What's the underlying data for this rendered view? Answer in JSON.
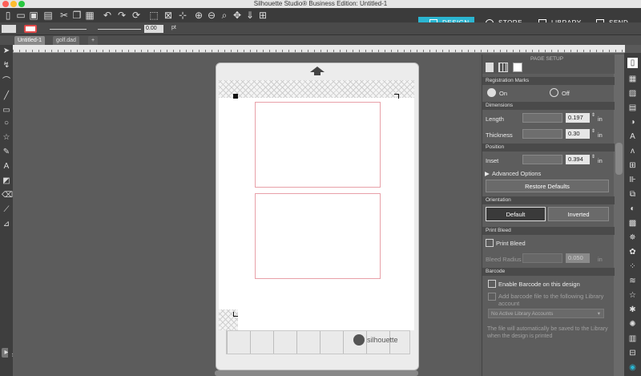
{
  "window": {
    "title": "Silhouette Studio® Business Edition: Untitled-1"
  },
  "nav": {
    "design": "DESIGN",
    "store": "STORE",
    "library": "LIBRARY",
    "send": "SEND"
  },
  "toolbar2": {
    "line_width_value": "0.00",
    "line_width_unit": "pt"
  },
  "tabs": [
    {
      "label": "Untitled-1"
    },
    {
      "label": "golf.dad"
    },
    {
      "label": "+"
    }
  ],
  "panel": {
    "header": "PAGE SETUP",
    "registration_marks": {
      "title": "Registration Marks",
      "on": "On",
      "off": "Off"
    },
    "dimensions": {
      "title": "Dimensions",
      "length_label": "Length",
      "length_value": "0.197",
      "thickness_label": "Thickness",
      "thickness_value": "0.30",
      "unit": "in"
    },
    "position": {
      "title": "Position",
      "inset_label": "Inset",
      "inset_value": "0.394",
      "unit": "in"
    },
    "advanced_options": "Advanced Options",
    "restore_defaults": "Restore Defaults",
    "orientation": {
      "title": "Orientation",
      "default": "Default",
      "inverted": "Inverted"
    },
    "print_bleed": {
      "title": "Print Bleed",
      "checkbox": "Print Bleed",
      "radius_label": "Bleed Radius",
      "radius_value": "0.050",
      "unit": "in"
    },
    "barcode": {
      "title": "Barcode",
      "enable": "Enable Barcode on this design",
      "add_file": "Add barcode file to the following Library account",
      "select": "No Active Library Accounts",
      "note": "The file will automatically be saved to the Library when the design is printed"
    }
  },
  "mat": {
    "brand": "silhouette"
  },
  "colors": {
    "accent": "#2bb5d1",
    "registration_border": "#e8a0a8"
  }
}
